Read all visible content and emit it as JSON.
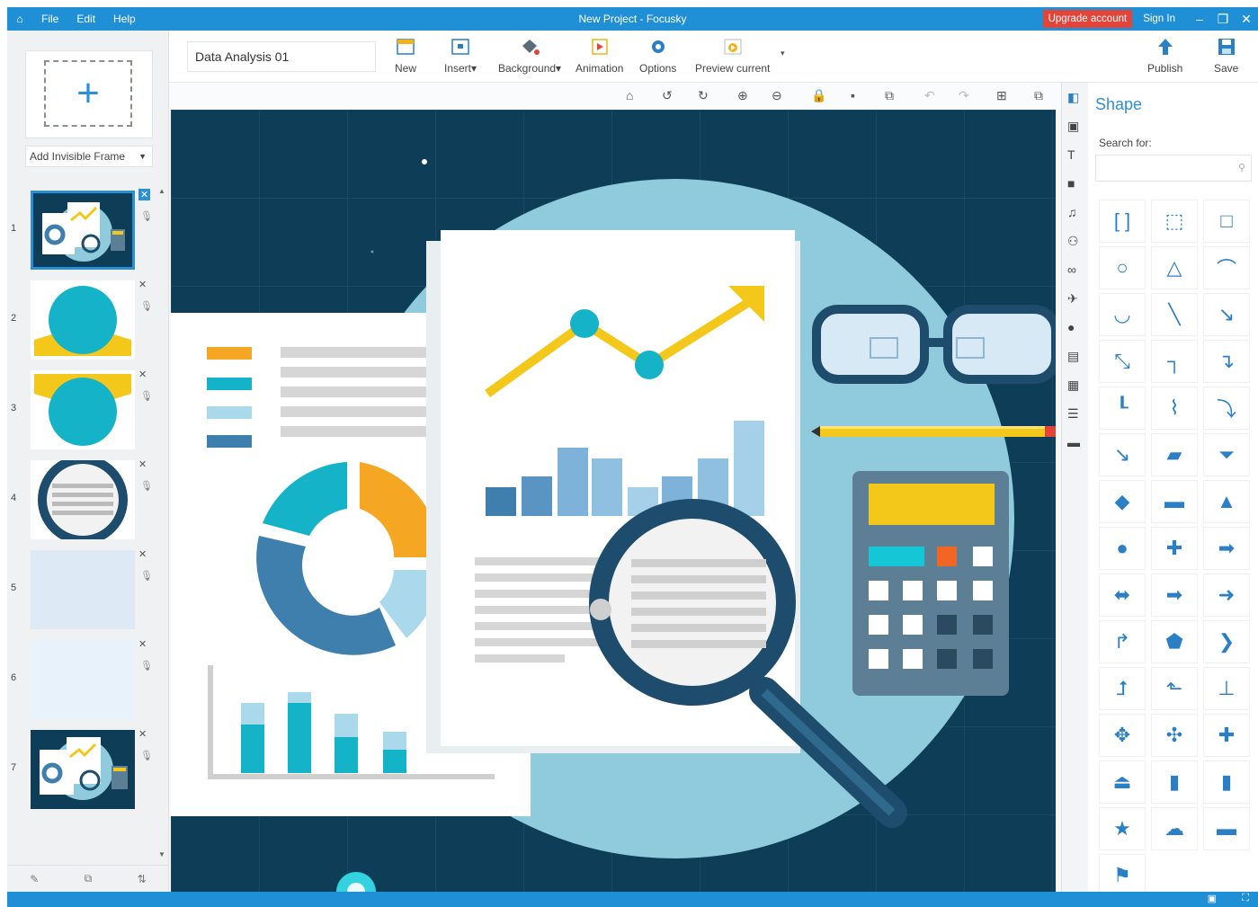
{
  "titlebar": {
    "menu": [
      "File",
      "Edit",
      "Help"
    ],
    "title": "New Project - Focusky",
    "upgrade": "Upgrade account",
    "signin": "Sign In"
  },
  "toolbar": {
    "project_name": "Data Analysis 01",
    "buttons": {
      "new": "New",
      "insert": "Insert",
      "background": "Background",
      "animation": "Animation",
      "options": "Options",
      "preview": "Preview current",
      "publish": "Publish",
      "save": "Save"
    }
  },
  "left": {
    "add_frame": "Add Invisible Frame",
    "slides": [
      {
        "num": "1",
        "selected": true
      },
      {
        "num": "2"
      },
      {
        "num": "3"
      },
      {
        "num": "4"
      },
      {
        "num": "5"
      },
      {
        "num": "6"
      },
      {
        "num": "7"
      }
    ]
  },
  "right": {
    "title": "Shape",
    "search_label": "Search for:",
    "shapes": [
      "brackets-icon",
      "dotted-rectangle-icon",
      "rectangle-icon",
      "circle-icon",
      "triangle-icon",
      "arc-icon",
      "curve-icon",
      "line-icon",
      "arrow-line-icon",
      "double-arrow-line-icon",
      "elbow-connector-icon",
      "elbow-arrow-icon",
      "elbow-connector-2-icon",
      "curved-connector-icon",
      "curved-arrow-icon",
      "diagonal-line-icon",
      "parallelogram-icon",
      "trapezoid-icon",
      "diamond-icon",
      "rounded-rectangle-icon",
      "filled-triangle-icon",
      "filled-circle-icon",
      "cross-icon",
      "right-arrow-icon",
      "left-right-arrow-icon",
      "thick-right-arrow-icon",
      "notched-arrow-icon",
      "turn-arrow-icon",
      "pentagon-arrow-icon",
      "chevron-icon",
      "up-turn-arrow-icon",
      "left-up-arrow-icon",
      "up-arrow-callout-icon",
      "four-way-arrow-icon",
      "quad-arrow-icon",
      "cross-arrow-icon",
      "up-arrow-box-icon",
      "callout-icon",
      "speech-bubble-icon",
      "star-icon",
      "cloud-icon",
      "banner-icon",
      "ribbon-icon"
    ]
  },
  "colors": {
    "accent": "#1f8fd6",
    "canvas_bg": "#0e3d57",
    "teal": "#15b3c8",
    "orange": "#f5a623",
    "yellow": "#f4c81a"
  }
}
